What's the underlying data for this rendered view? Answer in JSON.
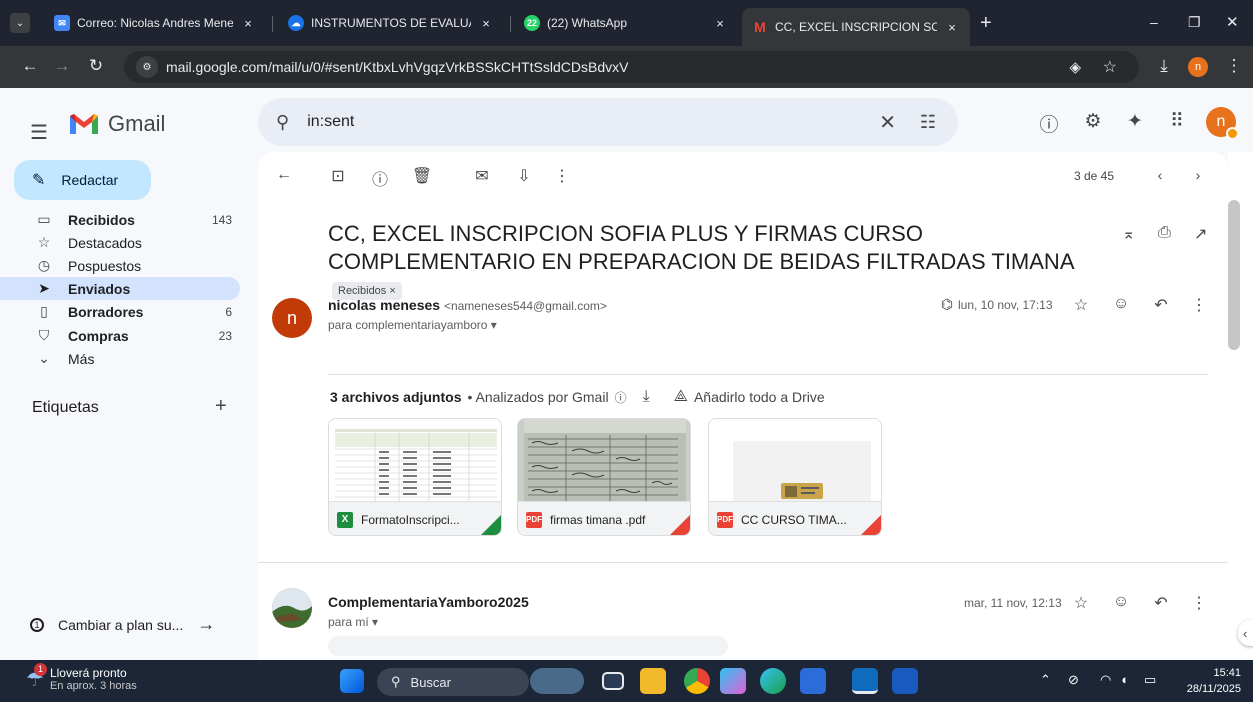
{
  "browser": {
    "tabs": [
      {
        "title": "Correo: Nicolas Andres Meneses",
        "close": "×"
      },
      {
        "title": "INSTRUMENTOS DE EVALUACIÓN",
        "close": "×"
      },
      {
        "title": "(22) WhatsApp",
        "badge": "22",
        "close": "×"
      },
      {
        "title": "CC, EXCEL INSCRIPCION SOFIA",
        "close": "×"
      }
    ],
    "new_tab": "+",
    "url": "mail.google.com/mail/u/0/#sent/KtbxLvhVgqzVrkBSSkCHTtSsldCDsBdvxV",
    "profile_initial": "n",
    "window_controls": {
      "min": "–",
      "max": "❐",
      "close": "✕"
    }
  },
  "gmail": {
    "brand": "Gmail",
    "search_query": "in:sent",
    "compose_label": "Redactar",
    "nav": [
      {
        "icon": "inbox-icon",
        "label": "Recibidos",
        "count": "143",
        "bold": true
      },
      {
        "icon": "star-icon",
        "label": "Destacados",
        "count": ""
      },
      {
        "icon": "snooze-icon",
        "label": "Pospuestos",
        "count": ""
      },
      {
        "icon": "send-icon",
        "label": "Enviados",
        "count": "",
        "bold": true,
        "selected": true
      },
      {
        "icon": "draft-icon",
        "label": "Borradores",
        "count": "6",
        "bold": true
      },
      {
        "icon": "shopping-icon",
        "label": "Compras",
        "count": "23",
        "bold": true
      },
      {
        "icon": "chevron-down-icon",
        "label": "Más",
        "count": ""
      }
    ],
    "labels_heading": "Etiquetas",
    "labels_add": "+",
    "upgrade_label": "Cambiar a plan su...",
    "avatar_initial": "n"
  },
  "thread": {
    "pager": "3 de 45",
    "subject": "CC, EXCEL INSCRIPCION SOFIA PLUS Y FIRMAS CURSO COMPLEMENTARIO EN PREPARACION DE BEIDAS FILTRADAS TIMANA",
    "subject_chip": "Recibidos ×",
    "messages": [
      {
        "avatar": "n",
        "sender_name": "nicolas meneses",
        "sender_email": "<nameneses544@gmail.com>",
        "to": "para complementariayamboro ▾",
        "date": "lun, 10 nov, 17:13"
      },
      {
        "avatar": "",
        "sender_name": "ComplementariaYamboro2025",
        "to": "para mí ▾",
        "date": "mar, 11 nov, 12:13"
      }
    ],
    "attachments_heading": "3 archivos adjuntos",
    "attachments_scan": "• Analizados por Gmail",
    "attachments_drive": "Añadirlo todo a Drive",
    "attachments": [
      {
        "name": "FormatoInscripci...",
        "badge": "X",
        "badge_color": "#1e8e3e",
        "corner_color": "#1e8e3e"
      },
      {
        "name": "firmas timana .pdf",
        "badge": "PDF",
        "badge_color": "#ea4335",
        "corner_color": "#ea4335"
      },
      {
        "name": "CC CURSO TIMA...",
        "badge": "PDF",
        "badge_color": "#ea4335",
        "corner_color": "#ea4335"
      }
    ]
  },
  "taskbar": {
    "weather_title": "Lloverá pronto",
    "weather_sub": "En aprox. 3 horas",
    "weather_badge": "1",
    "search_label": "Buscar",
    "time": "15:41",
    "date": "28/11/2025"
  }
}
